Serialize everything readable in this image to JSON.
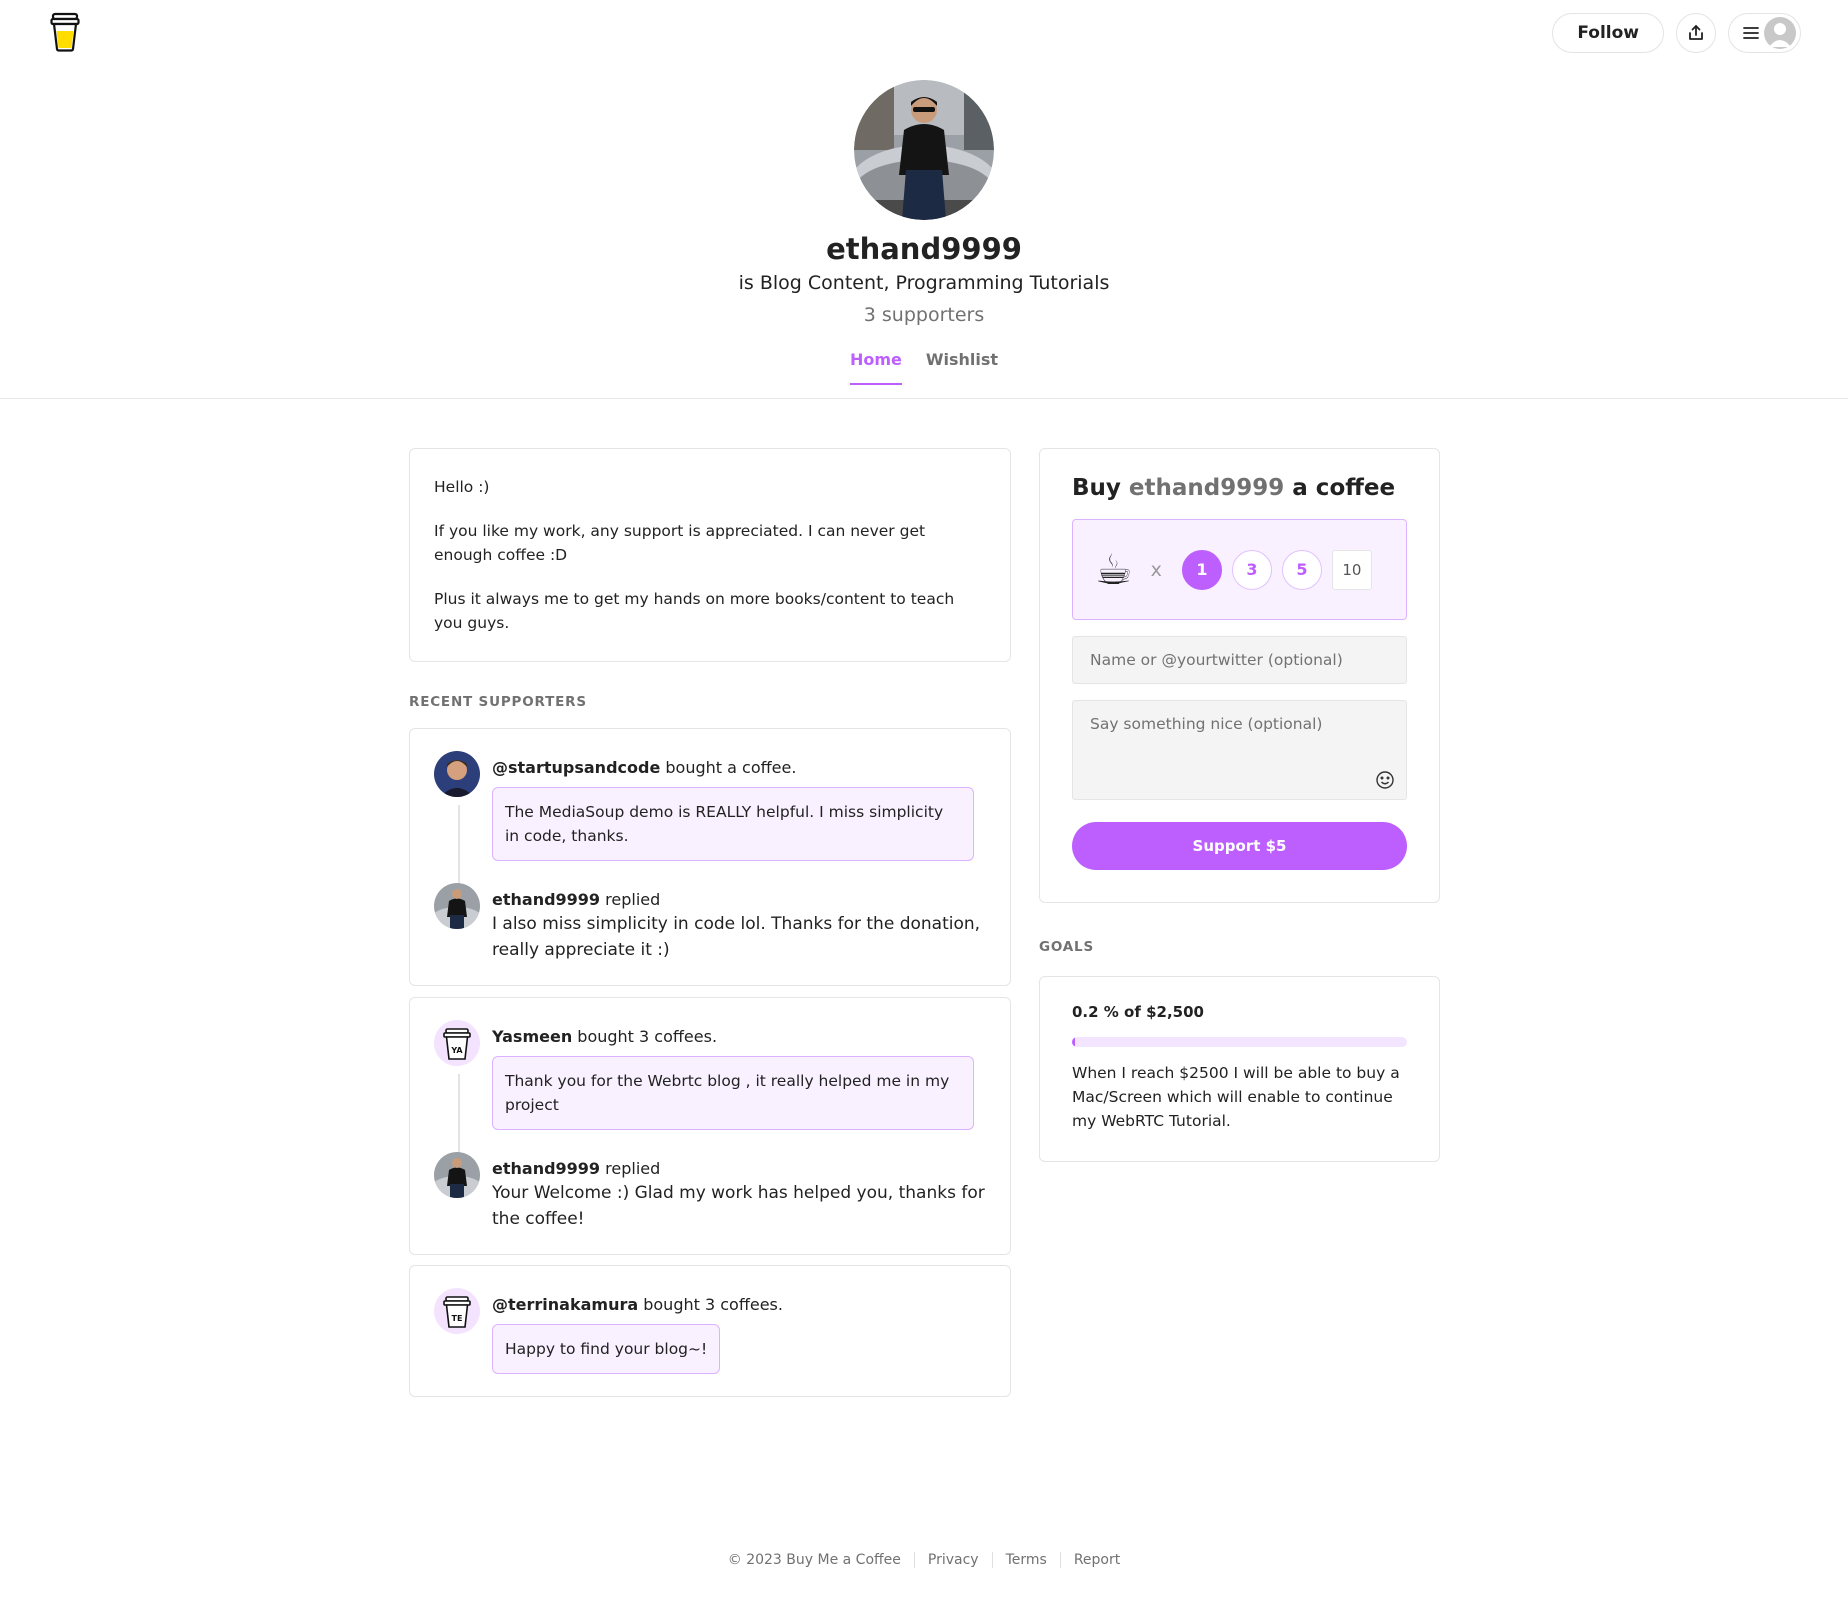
{
  "header": {
    "follow_label": "Follow"
  },
  "profile": {
    "name": "ethand9999",
    "tagline": "is Blog Content, Programming Tutorials",
    "supporters": "3 supporters"
  },
  "tabs": [
    {
      "label": "Home",
      "active": true
    },
    {
      "label": "Wishlist",
      "active": false
    }
  ],
  "about": {
    "paragraphs": [
      "Hello :)",
      "If you like my work, any support is appreciated. I can never get enough coffee :D",
      "Plus it always me to get my hands on more books/content to teach you guys."
    ]
  },
  "recent_supporters": {
    "label": "RECENT SUPPORTERS",
    "items": [
      {
        "name": "@startupsandcode",
        "action": "bought a coffee.",
        "message": "The MediaSoup demo is REALLY helpful. I miss simplicity in code, thanks.",
        "reply_name": "ethand9999",
        "reply_action": "replied",
        "reply_text": "I also miss simplicity in code lol. Thanks for the donation, really appreciate it :)"
      },
      {
        "name": "Yasmeen",
        "action": "bought 3 coffees.",
        "initials": "YA",
        "message": "Thank you for the Webrtc blog , it really helped me in my project",
        "reply_name": "ethand9999",
        "reply_action": "replied",
        "reply_text": "Your Welcome :) Glad my work has helped you, thanks for the coffee!"
      },
      {
        "name": "@terrinakamura",
        "action": "bought 3 coffees.",
        "initials": "TE",
        "message": "Happy to find your blog~!"
      }
    ]
  },
  "buy": {
    "title_prefix": "Buy",
    "title_name": "ethand9999",
    "title_suffix": "a coffee",
    "cup_icon": "☕",
    "multiplier": "x",
    "quantities": [
      "1",
      "3",
      "5"
    ],
    "selected_quantity": "1",
    "custom_quantity": "10",
    "name_placeholder": "Name or @yourtwitter (optional)",
    "message_placeholder": "Say something nice (optional)",
    "support_label": "Support $5"
  },
  "goals": {
    "label": "GOALS",
    "heading": "0.2 % of $2,500",
    "progress_percent": 0.2,
    "description": "When I reach $2500 I will be able to buy a Mac/Screen which will enable to continue my WebRTC Tutorial."
  },
  "footer": {
    "copyright": "© 2023 Buy Me a Coffee",
    "links": [
      "Privacy",
      "Terms",
      "Report"
    ]
  },
  "colors": {
    "accent": "#bd5fff",
    "accent_light": "#f9f1ff",
    "logo_yellow": "#ffdd00"
  }
}
